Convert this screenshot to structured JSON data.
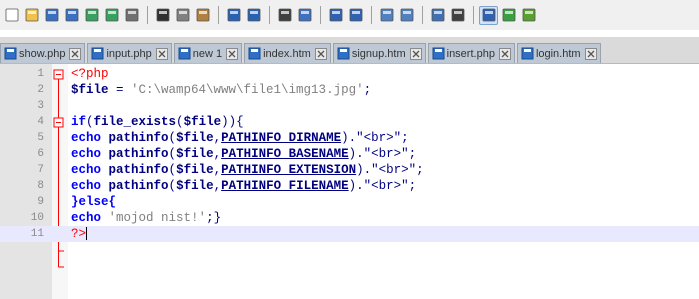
{
  "toolbar": {
    "icons": [
      "new-file-icon",
      "open-file-icon",
      "save-icon",
      "save-all-icon",
      "close-icon",
      "close-all-icon",
      "print-icon",
      "cut-icon",
      "copy-icon",
      "paste-icon",
      "undo-icon",
      "redo-icon",
      "find-icon",
      "replace-icon",
      "zoom-in-icon",
      "zoom-out-icon",
      "sync-vertical-icon",
      "sync-horizontal-icon",
      "word-wrap-icon",
      "show-all-characters-icon",
      "indent-guide-icon",
      "user-defined-language-icon",
      "document-map-icon"
    ],
    "active_icon": "indent-guide-icon"
  },
  "tabs": [
    {
      "label": "show.php"
    },
    {
      "label": "input.php"
    },
    {
      "label": "new 1"
    },
    {
      "label": "index.htm"
    },
    {
      "label": "signup.htm"
    },
    {
      "label": "insert.php"
    },
    {
      "label": "login.htm"
    }
  ],
  "editor": {
    "lines": [
      {
        "num": "1"
      },
      {
        "num": "2"
      },
      {
        "num": "3"
      },
      {
        "num": "4"
      },
      {
        "num": "5"
      },
      {
        "num": "6"
      },
      {
        "num": "7"
      },
      {
        "num": "8"
      },
      {
        "num": "9"
      },
      {
        "num": "10"
      },
      {
        "num": "11"
      }
    ],
    "tokens": {
      "php_open": "<?php",
      "file_var": "$file",
      "assign": " = ",
      "path_string": "'C:\\wamp64\\www\\file1\\img13.jpg'",
      "semicolon": ";",
      "if_kw": "if",
      "open_paren": "(",
      "file_exists_fn": "file_exists",
      "close_brace_open": ")){",
      "echo_kw": "echo",
      "pathinfo_fn": "pathinfo",
      "comma": ",",
      "dirname_const": "PATHINFO_DIRNAME",
      "basename_const": "PATHINFO_BASENAME",
      "extension_const": "PATHINFO_EXTENSION",
      "filename_const": "PATHINFO_FILENAME",
      "concat_br": ").\"<br>\";",
      "else_open": "}else{",
      "mojod_string": "'mojod nist!'",
      "end_brace": ";}",
      "php_close": "?>"
    }
  },
  "colors": {
    "keyword": "#0000ff",
    "php_tag": "#ff0000",
    "string": "#808080",
    "current_line": "#e8e8ff",
    "gutter": "#e4e4e4",
    "tab_bar": "#dadada"
  }
}
